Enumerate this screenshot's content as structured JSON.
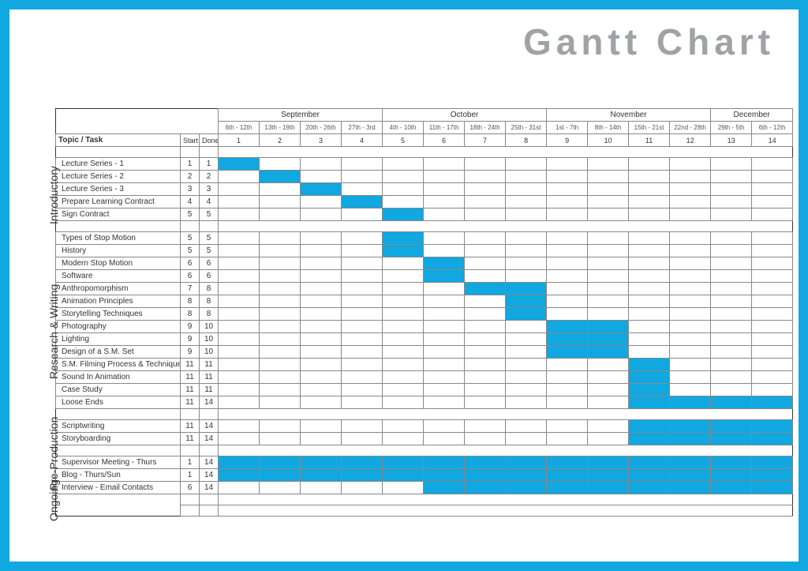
{
  "title": "Gantt Chart",
  "columns": {
    "task_header": "Topic / Task",
    "start": "Start",
    "done": "Done"
  },
  "months": [
    {
      "name": "September",
      "weeks": 4
    },
    {
      "name": "October",
      "weeks": 4
    },
    {
      "name": "November",
      "weeks": 4
    },
    {
      "name": "December",
      "weeks": 2
    }
  ],
  "date_ranges": [
    "6th - 12th",
    "13th - 19th",
    "20th - 26th",
    "27th - 3rd",
    "4th - 10th",
    "11th - 17th",
    "18th - 24th",
    "25th - 31st",
    "1st - 7th",
    "8th - 14th",
    "15th - 21st",
    "22nd - 28th",
    "29th - 5th",
    "6th - 12th"
  ],
  "week_numbers": [
    1,
    2,
    3,
    4,
    5,
    6,
    7,
    8,
    9,
    10,
    11,
    12,
    13,
    14
  ],
  "sections": [
    {
      "label": "Introductory",
      "tasks": [
        {
          "name": "Lecture Series - 1",
          "start": 1,
          "done": 1
        },
        {
          "name": "Lecture Series - 2",
          "start": 2,
          "done": 2
        },
        {
          "name": "Lecture Series - 3",
          "start": 3,
          "done": 3
        },
        {
          "name": "Prepare Learning Contract",
          "start": 4,
          "done": 4
        },
        {
          "name": "Sign Contract",
          "start": 5,
          "done": 5
        }
      ]
    },
    {
      "label": "Research & Writing",
      "tasks": [
        {
          "name": "Types of Stop Motion",
          "start": 5,
          "done": 5
        },
        {
          "name": "History",
          "start": 5,
          "done": 5
        },
        {
          "name": "Modern Stop Motion",
          "start": 6,
          "done": 6
        },
        {
          "name": "Software",
          "start": 6,
          "done": 6
        },
        {
          "name": "Anthropomorphism",
          "start": 7,
          "done": 8
        },
        {
          "name": "Animation Principles",
          "start": 8,
          "done": 8
        },
        {
          "name": "Storytelling Techniques",
          "start": 8,
          "done": 8
        },
        {
          "name": "Photography",
          "start": 9,
          "done": 10
        },
        {
          "name": "Lighting",
          "start": 9,
          "done": 10
        },
        {
          "name": "Design of a S.M. Set",
          "start": 9,
          "done": 10
        },
        {
          "name": "S.M. Filming Process & Techniques",
          "start": 11,
          "done": 11
        },
        {
          "name": "Sound In Animation",
          "start": 11,
          "done": 11
        },
        {
          "name": "Case Study",
          "start": 11,
          "done": 11
        },
        {
          "name": "Loose Ends",
          "start": 11,
          "done": 14
        }
      ]
    },
    {
      "label": "Pre-Production",
      "tasks": [
        {
          "name": "Scriptwriting",
          "start": 11,
          "done": 14
        },
        {
          "name": "Storyboarding",
          "start": 11,
          "done": 14
        }
      ]
    },
    {
      "label": "Ongoing",
      "tasks": [
        {
          "name": "Supervisor Meeting - Thurs",
          "start": 1,
          "done": 14
        },
        {
          "name": "Blog - Thurs/Sun",
          "start": 1,
          "done": 14
        },
        {
          "name": "Interview - Email Contacts",
          "start": 6,
          "done": 14
        }
      ]
    }
  ],
  "chart_data": {
    "type": "gantt",
    "title": "Gantt Chart",
    "x_categories": [
      1,
      2,
      3,
      4,
      5,
      6,
      7,
      8,
      9,
      10,
      11,
      12,
      13,
      14
    ],
    "x_labels_top": [
      "September",
      "September",
      "September",
      "September",
      "October",
      "October",
      "October",
      "October",
      "November",
      "November",
      "November",
      "November",
      "December",
      "December"
    ],
    "x_date_ranges": [
      "6th - 12th",
      "13th - 19th",
      "20th - 26th",
      "27th - 3rd",
      "4th - 10th",
      "11th - 17th",
      "18th - 24th",
      "25th - 31st",
      "1st - 7th",
      "8th - 14th",
      "15th - 21st",
      "22nd - 28th",
      "29th - 5th",
      "6th - 12th"
    ],
    "series": [
      {
        "group": "Introductory",
        "name": "Lecture Series - 1",
        "start": 1,
        "end": 1
      },
      {
        "group": "Introductory",
        "name": "Lecture Series - 2",
        "start": 2,
        "end": 2
      },
      {
        "group": "Introductory",
        "name": "Lecture Series - 3",
        "start": 3,
        "end": 3
      },
      {
        "group": "Introductory",
        "name": "Prepare Learning Contract",
        "start": 4,
        "end": 4
      },
      {
        "group": "Introductory",
        "name": "Sign Contract",
        "start": 5,
        "end": 5
      },
      {
        "group": "Research & Writing",
        "name": "Types of Stop Motion",
        "start": 5,
        "end": 5
      },
      {
        "group": "Research & Writing",
        "name": "History",
        "start": 5,
        "end": 5
      },
      {
        "group": "Research & Writing",
        "name": "Modern Stop Motion",
        "start": 6,
        "end": 6
      },
      {
        "group": "Research & Writing",
        "name": "Software",
        "start": 6,
        "end": 6
      },
      {
        "group": "Research & Writing",
        "name": "Anthropomorphism",
        "start": 7,
        "end": 8
      },
      {
        "group": "Research & Writing",
        "name": "Animation Principles",
        "start": 8,
        "end": 8
      },
      {
        "group": "Research & Writing",
        "name": "Storytelling Techniques",
        "start": 8,
        "end": 8
      },
      {
        "group": "Research & Writing",
        "name": "Photography",
        "start": 9,
        "end": 10
      },
      {
        "group": "Research & Writing",
        "name": "Lighting",
        "start": 9,
        "end": 10
      },
      {
        "group": "Research & Writing",
        "name": "Design of a S.M. Set",
        "start": 9,
        "end": 10
      },
      {
        "group": "Research & Writing",
        "name": "S.M. Filming Process & Techniques",
        "start": 11,
        "end": 11
      },
      {
        "group": "Research & Writing",
        "name": "Sound In Animation",
        "start": 11,
        "end": 11
      },
      {
        "group": "Research & Writing",
        "name": "Case Study",
        "start": 11,
        "end": 11
      },
      {
        "group": "Research & Writing",
        "name": "Loose Ends",
        "start": 11,
        "end": 14
      },
      {
        "group": "Pre-Production",
        "name": "Scriptwriting",
        "start": 11,
        "end": 14
      },
      {
        "group": "Pre-Production",
        "name": "Storyboarding",
        "start": 11,
        "end": 14
      },
      {
        "group": "Ongoing",
        "name": "Supervisor Meeting - Thurs",
        "start": 1,
        "end": 14
      },
      {
        "group": "Ongoing",
        "name": "Blog - Thurs/Sun",
        "start": 1,
        "end": 14
      },
      {
        "group": "Ongoing",
        "name": "Interview - Email Contacts",
        "start": 6,
        "end": 14
      }
    ]
  }
}
